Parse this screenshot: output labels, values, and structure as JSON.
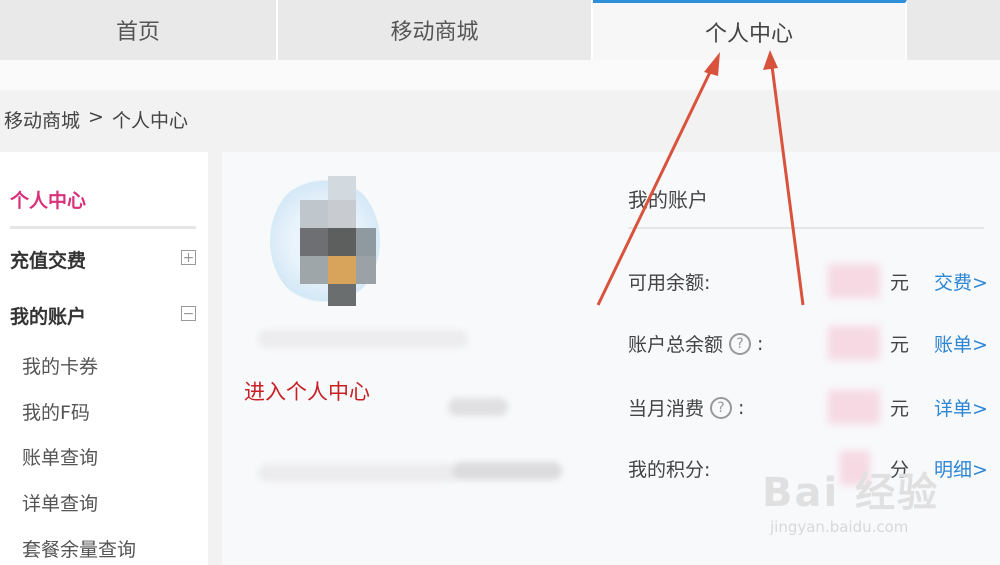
{
  "tabs": [
    {
      "label": "首页"
    },
    {
      "label": "移动商城"
    },
    {
      "label": "个人中心"
    },
    {
      "label": ""
    }
  ],
  "breadcrumb": {
    "parent": "移动商城",
    "separator": ">",
    "current": "个人中心"
  },
  "sidebar": {
    "current": "个人中心",
    "recharge": {
      "label": "充值交费",
      "toggle": "+"
    },
    "account": {
      "label": "我的账户",
      "toggle": "−"
    },
    "items": [
      {
        "label": "我的卡券"
      },
      {
        "label": "我的F码"
      },
      {
        "label": "账单查询"
      },
      {
        "label": "详单查询"
      },
      {
        "label": "套餐余量查询"
      }
    ]
  },
  "annotation": {
    "text": "进入个人中心",
    "color": "#c81f24"
  },
  "account": {
    "title": "我的账户",
    "rows": [
      {
        "label": "可用余额:",
        "unit": "元",
        "link": "交费>",
        "help": false
      },
      {
        "label": "账户总余额",
        "suffix": ":",
        "unit": "元",
        "link": "账单>",
        "help": true
      },
      {
        "label": "当月消费",
        "suffix": ":",
        "unit": "元",
        "link": "详单>",
        "help": true
      },
      {
        "label": "我的积分:",
        "unit": "分",
        "link": "明细>",
        "help": false
      }
    ]
  },
  "watermark": {
    "brand": "Bai 经验",
    "url": "jingyan.baidu.com"
  },
  "colors": {
    "accent": "#2f8fd9",
    "active_side": "#d9307a",
    "link": "#2d86d4",
    "arrow": "#d9533c"
  },
  "icons": {
    "help": "question-circle-icon",
    "expand": "plus-box-icon",
    "collapse": "minus-box-icon"
  }
}
